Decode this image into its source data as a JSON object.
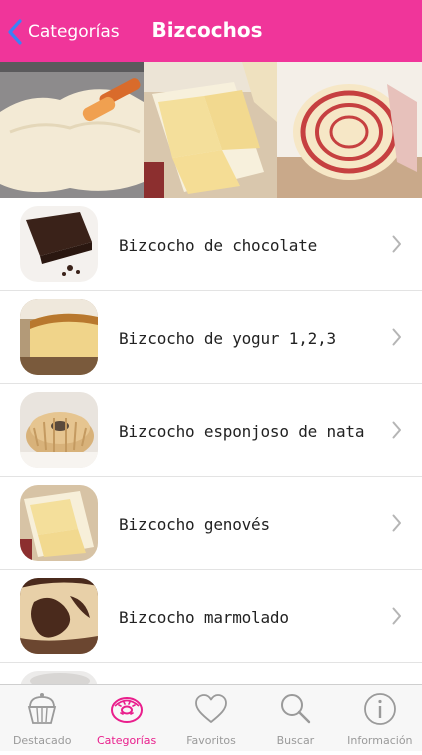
{
  "header": {
    "back_label": "Categorías",
    "title": "Bizcochos",
    "bg_color": "#f0359a",
    "accent_back": "#3b82f6"
  },
  "banner": {
    "photos": [
      "cake-batter-on-tray",
      "sponge-cake-sheets",
      "rolled-sponge-cake"
    ]
  },
  "list": {
    "items": [
      {
        "label": "Bizcocho de chocolate",
        "thumb": "chocolate-cake"
      },
      {
        "label": "Bizcocho de yogur 1,2,3",
        "thumb": "yogurt-loaf-cake"
      },
      {
        "label": "Bizcocho esponjoso de nata",
        "thumb": "bundt-cake"
      },
      {
        "label": "Bizcocho genovés",
        "thumb": "genoise-sheet"
      },
      {
        "label": "Bizcocho marmolado",
        "thumb": "marble-cake"
      }
    ]
  },
  "tabbar": {
    "tabs": [
      {
        "label": "Destacado",
        "icon": "cupcake-icon",
        "active": false
      },
      {
        "label": "Categorías",
        "icon": "donut-icon",
        "active": true
      },
      {
        "label": "Favoritos",
        "icon": "heart-icon",
        "active": false
      },
      {
        "label": "Buscar",
        "icon": "search-icon",
        "active": false
      },
      {
        "label": "Información",
        "icon": "info-icon",
        "active": false
      }
    ],
    "active_color": "#e91e8c",
    "inactive_color": "#9a9a9a"
  }
}
